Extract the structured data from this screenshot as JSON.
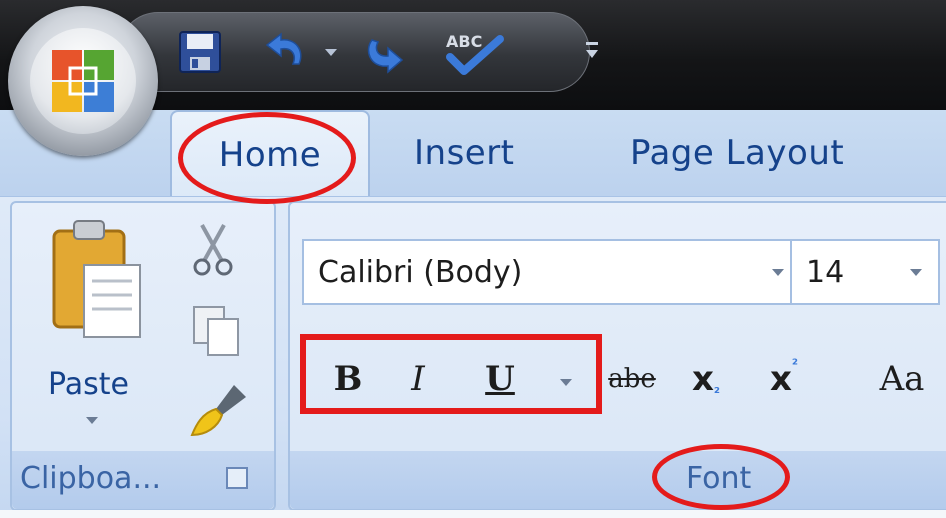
{
  "tabs": [
    {
      "label": "Home",
      "active": true
    },
    {
      "label": "Insert",
      "active": false
    },
    {
      "label": "Page Layout",
      "active": false
    }
  ],
  "quick_access": {
    "icons": [
      "save-icon",
      "undo-icon",
      "dropdown-arrow-icon",
      "redo-icon",
      "spelling-check-icon",
      "customize-toolbar-icon"
    ]
  },
  "clipboard": {
    "paste_label": "Paste",
    "group_label": "Clipboa..."
  },
  "font": {
    "font_name": "Calibri (Body)",
    "font_size": "14",
    "group_label": "Font",
    "buttons": [
      {
        "name": "bold",
        "label": "B"
      },
      {
        "name": "italic",
        "label": "I"
      },
      {
        "name": "underline",
        "label": "U"
      },
      {
        "name": "strikethrough",
        "label": "abe"
      },
      {
        "name": "subscript",
        "label": "x"
      },
      {
        "name": "superscript",
        "label": "x"
      },
      {
        "name": "change-case",
        "label": "Aa"
      }
    ]
  },
  "colors": {
    "annotation": "#e41b1b",
    "tab_text": "#15428b",
    "ribbon_bg": "#d2e1f5"
  }
}
